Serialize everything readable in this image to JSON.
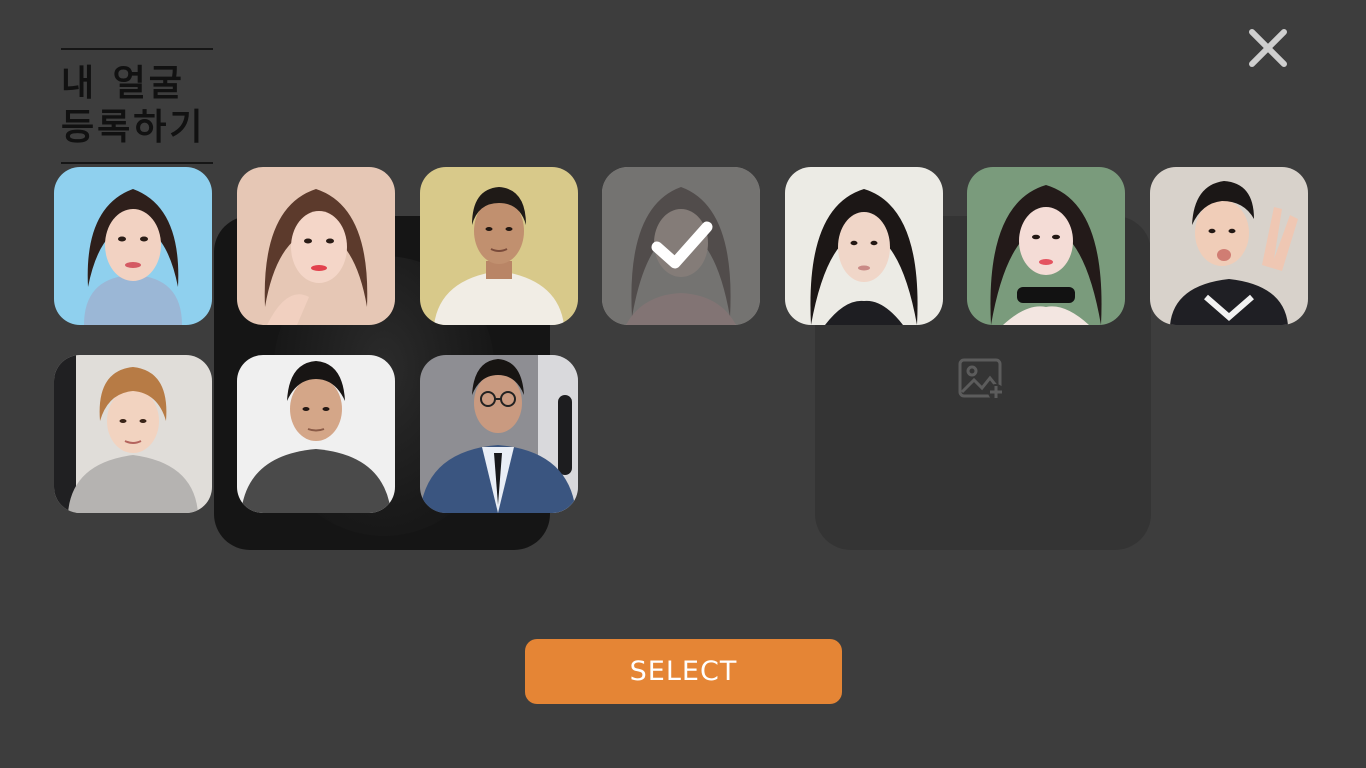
{
  "header": {
    "title_line1": "내 얼굴",
    "title_line2": "등록하기"
  },
  "icons": {
    "close": "close-icon",
    "add_photo": "add-photo-icon",
    "selected": "checkmark-icon"
  },
  "faces": [
    {
      "id": "face-1",
      "selected": false,
      "bg": "#8fd0ee"
    },
    {
      "id": "face-2",
      "selected": false,
      "bg": "#e6c7b5"
    },
    {
      "id": "face-3",
      "selected": false,
      "bg": "#d8c98a"
    },
    {
      "id": "face-4",
      "selected": true,
      "bg": "#b8b2ad"
    },
    {
      "id": "face-5",
      "selected": false,
      "bg": "#ecebe5"
    },
    {
      "id": "face-6",
      "selected": false,
      "bg": "#7a9b7c"
    },
    {
      "id": "face-7",
      "selected": false,
      "bg": "#d8d2cb"
    },
    {
      "id": "face-8",
      "selected": false,
      "bg": "#e0ddd9"
    },
    {
      "id": "face-9",
      "selected": false,
      "bg": "#f0f0f0"
    },
    {
      "id": "face-10",
      "selected": false,
      "bg": "#8e8e93"
    }
  ],
  "footer": {
    "select_label": "SELECT"
  },
  "colors": {
    "background": "#3d3d3d",
    "accent": "#e58535"
  }
}
